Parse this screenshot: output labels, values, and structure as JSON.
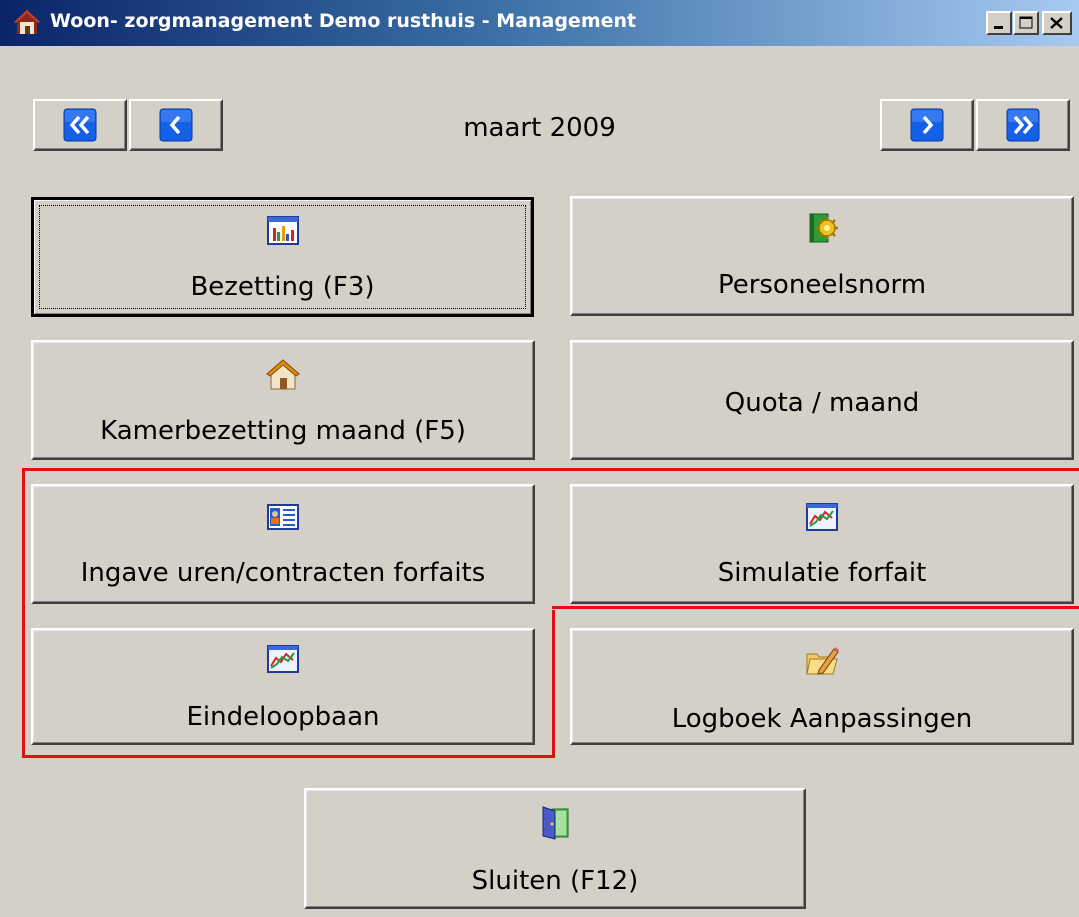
{
  "window": {
    "title": "Woon- zorgmanagement Demo rusthuis - Management",
    "controls": [
      "minimize-icon",
      "maximize-icon",
      "close-icon"
    ]
  },
  "navigation": {
    "period": "maart 2009",
    "first_icon": "double-chevron-left-icon",
    "prev_icon": "chevron-left-icon",
    "next_icon": "chevron-right-icon",
    "last_icon": "double-chevron-right-icon"
  },
  "buttons": {
    "bezetting": {
      "label": "Bezetting (F3)",
      "icon": "bar-chart-icon"
    },
    "personeelsnorm": {
      "label": "Personeelsnorm",
      "icon": "book-gear-icon"
    },
    "kamerbezetting": {
      "label": "Kamerbezetting maand (F5)",
      "icon": "house-icon"
    },
    "quota": {
      "label": "Quota / maand"
    },
    "ingave": {
      "label": "Ingave uren/contracten forfaits",
      "icon": "contact-card-icon"
    },
    "simulatie": {
      "label": "Simulatie forfait",
      "icon": "line-chart-icon"
    },
    "eindeloopbaan": {
      "label": "Eindeloopbaan",
      "icon": "line-chart-icon"
    },
    "logboek": {
      "label": "Logboek Aanpassingen",
      "icon": "folder-pencil-icon"
    },
    "sluiten": {
      "label": "Sluiten (F12)",
      "icon": "door-icon"
    }
  },
  "colors": {
    "highlight_border": "#e01010",
    "window_bg": "#d4d0c8",
    "titlebar_start": "#0a246a",
    "titlebar_end": "#a6caf0"
  }
}
